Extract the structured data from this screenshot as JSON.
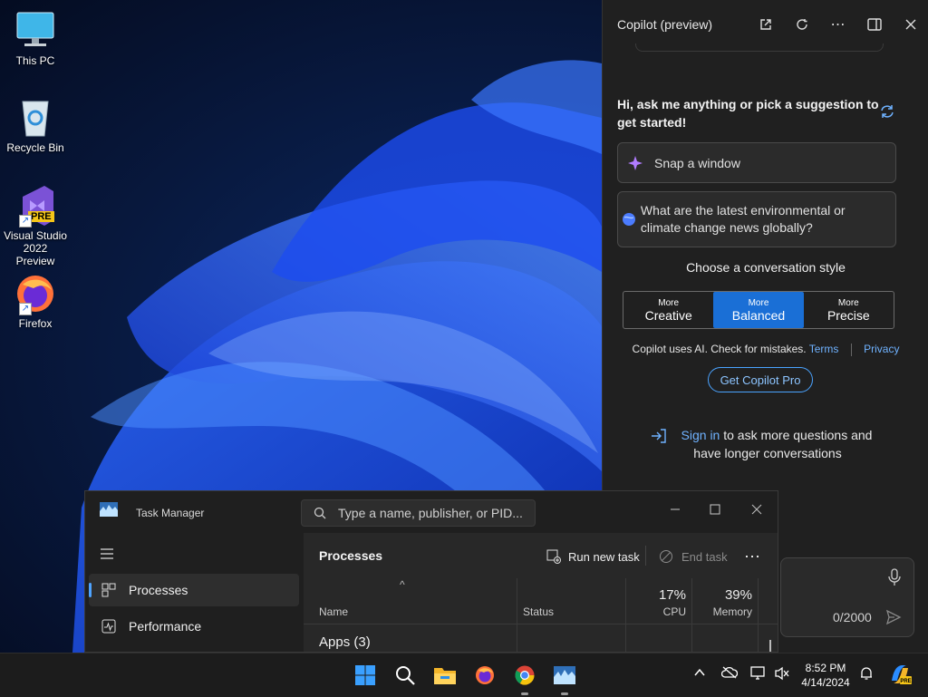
{
  "desktop": {
    "icons": [
      {
        "label": "This PC",
        "icon": "monitor-icon"
      },
      {
        "label": "Recycle Bin",
        "icon": "recycle-bin-icon"
      },
      {
        "label": "Visual Studio 2022 Preview",
        "badge": "PRE",
        "icon": "visual-studio-icon"
      },
      {
        "label": "Firefox",
        "icon": "firefox-icon"
      }
    ]
  },
  "copilot": {
    "title": "Copilot (preview)",
    "greeting": "Hi, ask me anything or pick a suggestion to get started!",
    "suggestions": [
      {
        "text": "Snap a window",
        "icon": "sparkle-icon"
      },
      {
        "text": "What are the latest environmental or climate change news globally?",
        "icon": "globe-icon"
      }
    ],
    "style_label": "Choose a conversation style",
    "styles": [
      {
        "small": "More",
        "large": "Creative",
        "active": false
      },
      {
        "small": "More",
        "large": "Balanced",
        "active": true
      },
      {
        "small": "More",
        "large": "Precise",
        "active": false
      }
    ],
    "disclaimer": "Copilot uses AI. Check for mistakes.",
    "terms": "Terms",
    "privacy": "Privacy",
    "pro_button": "Get Copilot Pro",
    "signin_link": "Sign in",
    "signin_rest": " to ask more questions and have longer conversations",
    "counter": "0/2000"
  },
  "taskmanager": {
    "title": "Task Manager",
    "search_placeholder": "Type a name, publisher, or PID...",
    "nav": [
      {
        "label": "Processes",
        "icon": "processes-icon",
        "active": true
      },
      {
        "label": "Performance",
        "icon": "performance-icon",
        "active": false
      }
    ],
    "heading": "Processes",
    "run_new_task": "Run new task",
    "end_task": "End task",
    "columns": {
      "name": "Name",
      "status": "Status",
      "cpu_pct": "17%",
      "cpu": "CPU",
      "memory_pct": "39%",
      "memory": "Memory"
    },
    "group": "Apps (3)"
  },
  "taskbar": {
    "time": "8:52 PM",
    "date": "4/14/2024",
    "apps": [
      "start-icon",
      "search-icon",
      "file-explorer-icon",
      "firefox-icon",
      "chrome-icon",
      "task-manager-icon"
    ]
  }
}
